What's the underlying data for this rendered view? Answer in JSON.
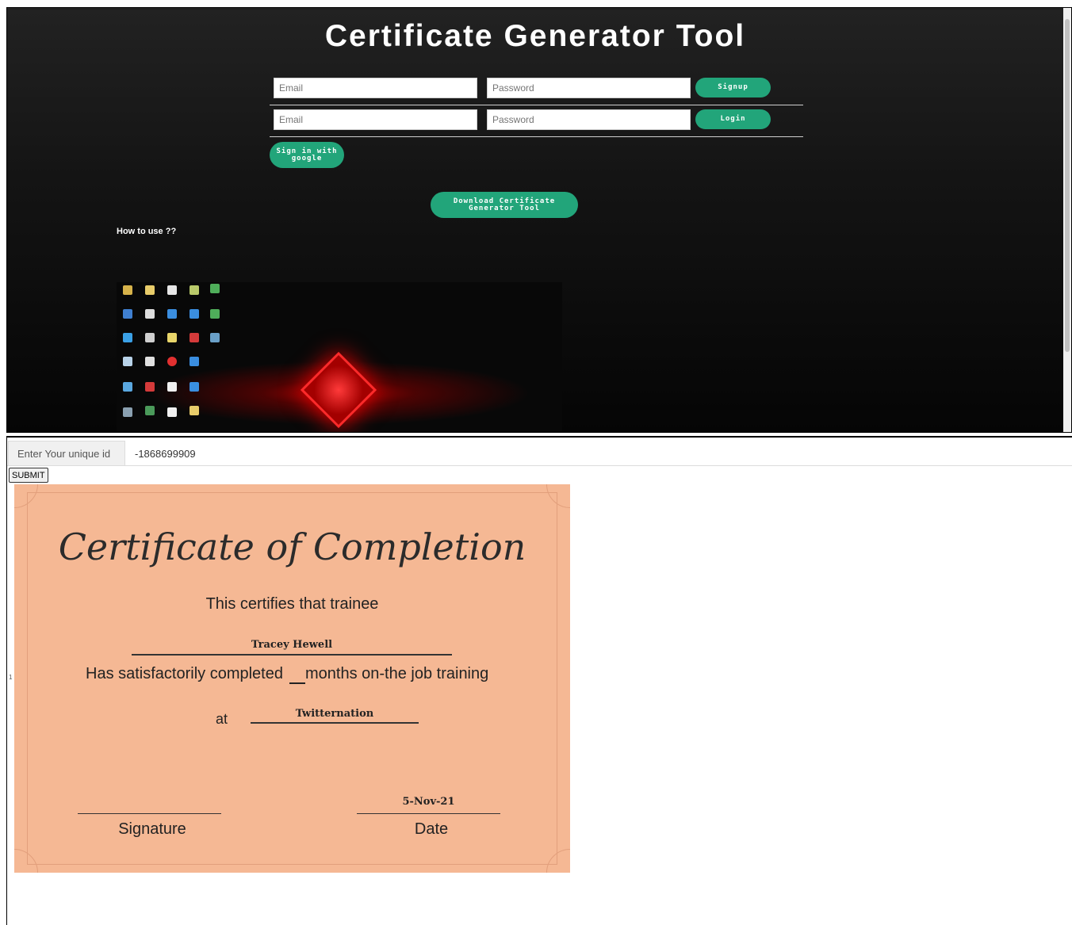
{
  "app": {
    "title": "Certificate Generator Tool"
  },
  "signup": {
    "email_placeholder": "Email",
    "password_placeholder": "Password",
    "button_label": "Signup"
  },
  "login": {
    "email_placeholder": "Email",
    "password_placeholder": "Password",
    "button_label": "Login"
  },
  "google_button_label": "Sign in with google",
  "download_button_label": "Download Certificate Generator Tool",
  "howto_label": "How to use ??",
  "unique_id": {
    "prefix_label": "Enter Your unique id",
    "value": "-1868699909"
  },
  "submit_label": "SUBMIT",
  "tiny_mark": "1",
  "certificate": {
    "title": "Certificate of Completion",
    "subtitle": "This certifies that trainee",
    "trainee_name": "Tracey Hewell",
    "completed_text": "Has satisfactorily completed",
    "months_value": "",
    "months_text": "months on-the job training",
    "at_label": "at",
    "company": "Twitternation",
    "signature_label": "Signature",
    "date_value": "5-Nov-21",
    "date_label": "Date"
  },
  "colors": {
    "accent_green": "#22a57a",
    "certificate_bg": "#f5b894"
  }
}
